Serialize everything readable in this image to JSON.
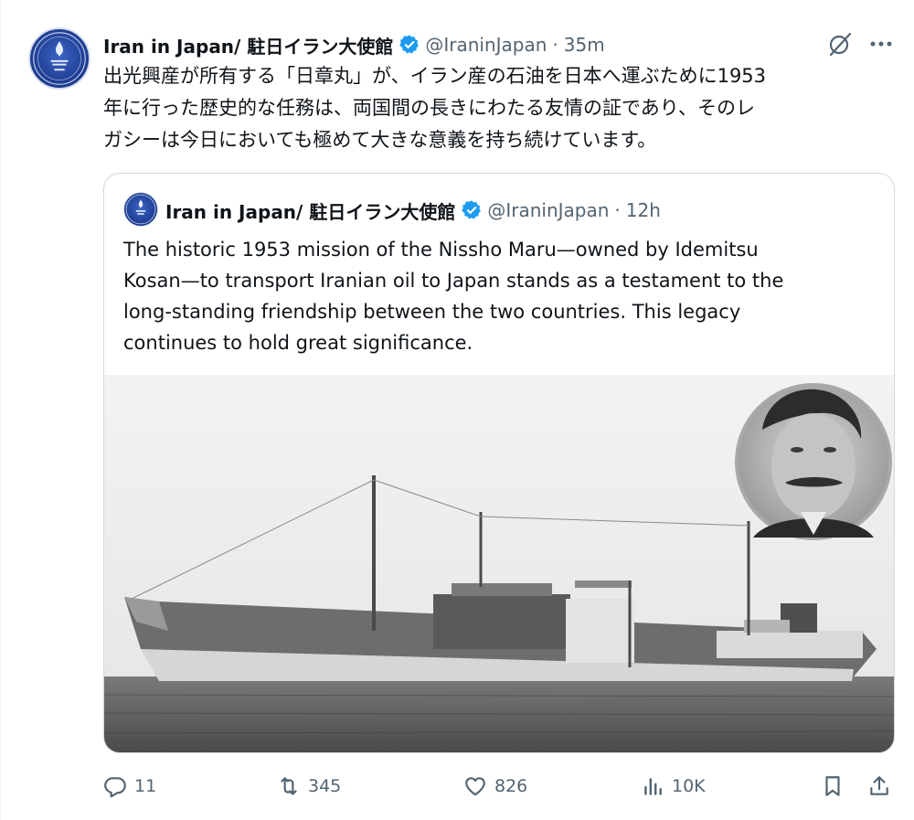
{
  "tweet": {
    "author_name": "Iran in Japan/ 駐日イラン大使館",
    "author_handle": "@IraninJapan",
    "separator": "·",
    "time": "35m",
    "body_lines": [
      "出光興産が所有する「日章丸」が、イラン産の石油を日本へ運ぶために1953",
      "年に行った歴史的な任務は、両国間の長きにわたる友情の証であり、そのレ",
      "ガシーは今日においても極めて大きな意義を持ち続けています。"
    ]
  },
  "quote": {
    "author_name": "Iran in Japan/ 駐日イラン大使館",
    "author_handle": "@IraninJapan",
    "separator": "·",
    "time": "12h",
    "body_lines": [
      "The historic 1953 mission of the Nissho Maru—owned by Idemitsu",
      "Kosan—to transport Iranian oil to Japan stands as a testament to the",
      "long-standing friendship between the two countries. This legacy",
      "continues to hold great significance."
    ]
  },
  "actions": {
    "replies": "11",
    "retweets": "345",
    "likes": "826",
    "views": "10K"
  },
  "icons": {
    "reply": "reply-icon",
    "retweet": "retweet-icon",
    "like": "heart-icon",
    "views": "views-chart-icon",
    "bookmark": "bookmark-icon",
    "share": "share-icon",
    "grok": "grok-icon",
    "more": "more-icon",
    "verified": "verified-badge-icon"
  },
  "colors": {
    "verified_blue": "#1d9bf0",
    "text_primary": "#0f1419",
    "text_secondary": "#536471",
    "border": "#cfd9de"
  }
}
